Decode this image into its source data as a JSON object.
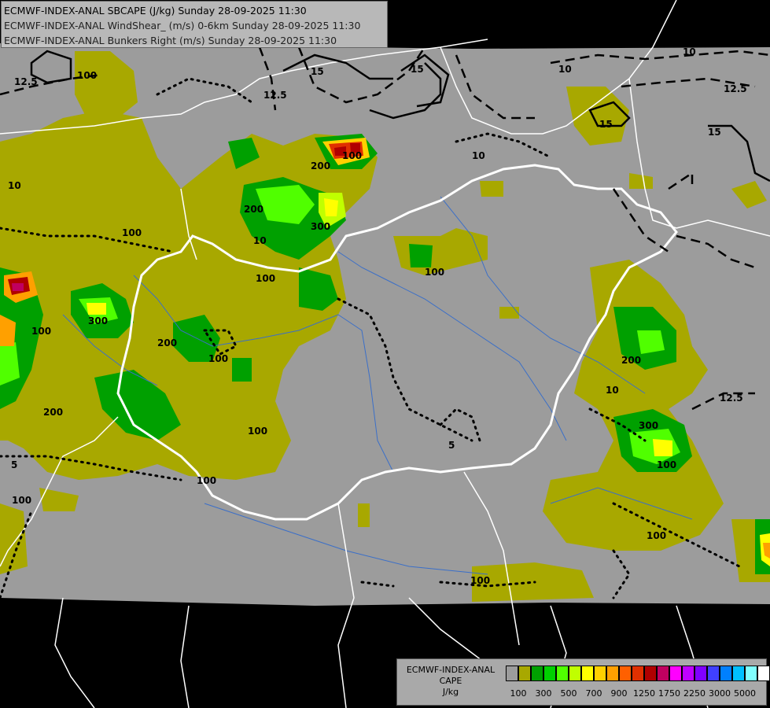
{
  "header": {
    "line1": "ECMWF-INDEX-ANAL SBCAPE (J/kg) Sunday 28-09-2025 11:30",
    "line2": "ECMWF-INDEX-ANAL WindShear_ (m/s) 0-6km Sunday 28-09-2025 11:30",
    "line3": "ECMWF-INDEX-ANAL Bunkers Right (m/s) Sunday 28-09-2025 11:30"
  },
  "legend": {
    "title_line1": "ECMWF-INDEX-ANAL",
    "title_line2": "CAPE",
    "title_line3": "J/kg",
    "colors": [
      "#9c9c9c",
      "#a8a800",
      "#00a000",
      "#00d000",
      "#50ff00",
      "#c0ff00",
      "#ffff00",
      "#ffd000",
      "#ffa000",
      "#ff6000",
      "#e03000",
      "#b00000",
      "#c00060",
      "#ff00ff",
      "#c000ff",
      "#8000ff",
      "#4040ff",
      "#0080ff",
      "#00c0ff",
      "#80ffff",
      "#ffffff"
    ],
    "ticks": [
      "100",
      "300",
      "500",
      "700",
      "900",
      "1250",
      "1750",
      "2250",
      "3000",
      "5000"
    ]
  },
  "contour_labels": {
    "shear": [
      "12.5",
      "10",
      "10",
      "12.5",
      "15",
      "15",
      "15",
      "10",
      "12.5",
      "10",
      "5",
      "5",
      "10",
      "12.5",
      "15",
      "10"
    ],
    "cape": [
      "100",
      "200",
      "300",
      "100",
      "100",
      "200",
      "100",
      "100",
      "100",
      "200",
      "300",
      "100",
      "100",
      "100",
      "200",
      "200",
      "300",
      "100",
      "100",
      "100",
      "100"
    ]
  }
}
